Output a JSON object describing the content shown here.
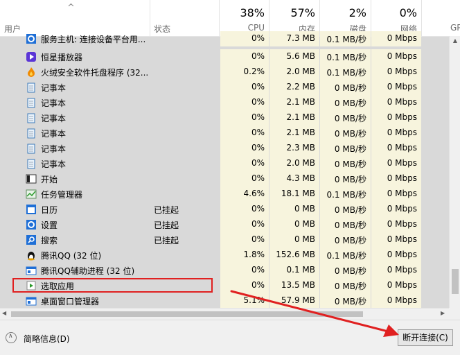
{
  "header": {
    "sort_arrow": "^",
    "user_label": "用户",
    "status_label": "状态",
    "cpu": {
      "pct": "38%",
      "label": "CPU"
    },
    "memory": {
      "pct": "57%",
      "label": "内存"
    },
    "disk": {
      "pct": "2%",
      "label": "磁盘"
    },
    "network": {
      "pct": "0%",
      "label": "网络"
    },
    "gpu": {
      "label": "GP"
    }
  },
  "rows": [
    {
      "name": "服务主机: 连接设备平台用...",
      "icon": "gear-icon",
      "status": "",
      "cpu": "0%",
      "memory": "7.3 MB",
      "disk": "0.1 MB/秒",
      "network": "0 Mbps",
      "partial": true
    },
    {
      "name": "恒星播放器",
      "icon": "player-icon",
      "status": "",
      "cpu": "0%",
      "memory": "5.6 MB",
      "disk": "0.1 MB/秒",
      "network": "0 Mbps"
    },
    {
      "name": "火绒安全软件托盘程序 (32...",
      "icon": "flame-icon",
      "status": "",
      "cpu": "0.2%",
      "memory": "2.0 MB",
      "disk": "0.1 MB/秒",
      "network": "0 Mbps"
    },
    {
      "name": "记事本",
      "icon": "notepad-icon",
      "status": "",
      "cpu": "0%",
      "memory": "2.2 MB",
      "disk": "0 MB/秒",
      "network": "0 Mbps"
    },
    {
      "name": "记事本",
      "icon": "notepad-icon",
      "status": "",
      "cpu": "0%",
      "memory": "2.1 MB",
      "disk": "0 MB/秒",
      "network": "0 Mbps"
    },
    {
      "name": "记事本",
      "icon": "notepad-icon",
      "status": "",
      "cpu": "0%",
      "memory": "2.1 MB",
      "disk": "0 MB/秒",
      "network": "0 Mbps"
    },
    {
      "name": "记事本",
      "icon": "notepad-icon",
      "status": "",
      "cpu": "0%",
      "memory": "2.1 MB",
      "disk": "0 MB/秒",
      "network": "0 Mbps"
    },
    {
      "name": "记事本",
      "icon": "notepad-icon",
      "status": "",
      "cpu": "0%",
      "memory": "2.3 MB",
      "disk": "0 MB/秒",
      "network": "0 Mbps"
    },
    {
      "name": "记事本",
      "icon": "notepad-icon",
      "status": "",
      "cpu": "0%",
      "memory": "2.0 MB",
      "disk": "0 MB/秒",
      "network": "0 Mbps"
    },
    {
      "name": "开始",
      "icon": "start-window-icon",
      "status": "",
      "cpu": "0%",
      "memory": "4.3 MB",
      "disk": "0 MB/秒",
      "network": "0 Mbps"
    },
    {
      "name": "任务管理器",
      "icon": "task-manager-icon",
      "status": "",
      "cpu": "4.6%",
      "memory": "18.1 MB",
      "disk": "0.1 MB/秒",
      "network": "0 Mbps"
    },
    {
      "name": "日历",
      "icon": "calendar-icon",
      "status": "已挂起",
      "cpu": "0%",
      "memory": "0 MB",
      "disk": "0 MB/秒",
      "network": "0 Mbps"
    },
    {
      "name": "设置",
      "icon": "settings-gear-icon",
      "status": "已挂起",
      "cpu": "0%",
      "memory": "0 MB",
      "disk": "0 MB/秒",
      "network": "0 Mbps"
    },
    {
      "name": "搜索",
      "icon": "search-icon",
      "status": "已挂起",
      "cpu": "0%",
      "memory": "0 MB",
      "disk": "0 MB/秒",
      "network": "0 Mbps"
    },
    {
      "name": "腾讯QQ (32 位)",
      "icon": "qq-penguin-icon",
      "status": "",
      "cpu": "1.8%",
      "memory": "152.6 MB",
      "disk": "0.1 MB/秒",
      "network": "0 Mbps"
    },
    {
      "name": "腾讯QQ辅助进程 (32 位)",
      "icon": "app-window-icon",
      "status": "",
      "cpu": "0%",
      "memory": "0.1 MB",
      "disk": "0 MB/秒",
      "network": "0 Mbps"
    },
    {
      "name": "选取应用",
      "icon": "pick-app-icon",
      "status": "",
      "cpu": "0%",
      "memory": "13.5 MB",
      "disk": "0 MB/秒",
      "network": "0 Mbps",
      "highlighted": true
    },
    {
      "name": "桌面窗口管理器",
      "icon": "app-window-icon",
      "status": "",
      "cpu": "5.1%",
      "memory": "57.9 MB",
      "disk": "0 MB/秒",
      "network": "0 Mbps"
    }
  ],
  "footer": {
    "fewer_details_label": "简略信息(D)",
    "end_task_label": "断开连接(C)"
  },
  "annotation": {
    "color": "#e02020"
  },
  "colors": {
    "heat_tint": "#f7f4dd",
    "panel_bg": "#d9d9d9"
  }
}
